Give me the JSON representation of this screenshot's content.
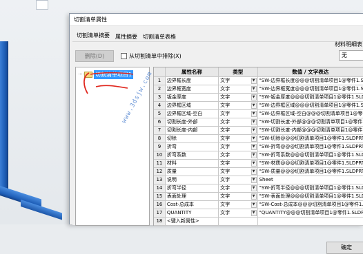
{
  "window": {
    "title": "切割清单属性"
  },
  "tabs": [
    {
      "label": "切割清单摘要"
    },
    {
      "label": "属性摘要"
    },
    {
      "label": "切割清单表格"
    }
  ],
  "toolbar": {
    "delete_label": "删除(D)",
    "exclude_label": "从切割清单中排除(X)",
    "material_label": "材料明细表",
    "material_value": "无"
  },
  "tree": {
    "item_label": "切割清单项目1"
  },
  "table": {
    "headers": [
      "",
      "属性名称",
      "类型",
      "数值 / 文字表达"
    ],
    "rows": [
      {
        "num": "1",
        "name": "边界框长度",
        "type": "文字",
        "value": "\"SW-边界框长度@@@切割清单项目1@零件1.SL"
      },
      {
        "num": "2",
        "name": "边界框宽度",
        "type": "文字",
        "value": "\"SW-边界框宽度@@@切割清单项目1@零件1.SL"
      },
      {
        "num": "3",
        "name": "钣金厚度",
        "type": "文字",
        "value": "\"SW-钣金厚度@@@切割清单项目1@零件1.SLD"
      },
      {
        "num": "4",
        "name": "边界框区域",
        "type": "文字",
        "value": "\"SW-边界框区域@@@切割清单项目1@零件1.SL"
      },
      {
        "num": "5",
        "name": "边界框区域-空白",
        "type": "文字",
        "value": "\"SW-边界框区域-空白@@@切割清单项目1@零件"
      },
      {
        "num": "6",
        "name": "切割长度-外部",
        "type": "文字",
        "value": "\"SW-切割长度-外部@@@切割清单项目1@零件1"
      },
      {
        "num": "7",
        "name": "切割长度-内部",
        "type": "文字",
        "value": "\"SW-切割长度-内部@@@切割清单项目1@零件1"
      },
      {
        "num": "8",
        "name": "切除",
        "type": "文字",
        "value": "\"SW-切除@@@切割清单项目1@零件1.SLDPRT\""
      },
      {
        "num": "9",
        "name": "折弯",
        "type": "文字",
        "value": "\"SW-折弯@@@切割清单项目1@零件1.SLDPRT\""
      },
      {
        "num": "10",
        "name": "折弯系数",
        "type": "文字",
        "value": "\"SW-折弯系数@@@切割清单项目1@零件1.SLD"
      },
      {
        "num": "11",
        "name": "材料",
        "type": "文字",
        "value": "\"SW-材质@@@切割清单项目1@零件1.SLDPRT\""
      },
      {
        "num": "12",
        "name": "质量",
        "type": "文字",
        "value": "\"SW-质量@@@切割清单项目1@零件1.SLDPRT\""
      },
      {
        "num": "13",
        "name": "说明",
        "type": "文字",
        "value": "Sheet"
      },
      {
        "num": "14",
        "name": "折弯半径",
        "type": "文字",
        "value": "\"SW-折弯半径@@@切割清单项目1@零件1.SLD"
      },
      {
        "num": "15",
        "name": "表面处理",
        "type": "文字",
        "value": "\"SW-表面处理@@@切割清单项目1@零件1.SLDP"
      },
      {
        "num": "16",
        "name": "Cost-总成本",
        "type": "文字",
        "value": "\"SW-Cost-总成本@@@切割清单项目1@零件1.S"
      },
      {
        "num": "17",
        "name": "QUANTITY",
        "type": "文字",
        "value": "\"QUANTITY@@@切割清单项目1@零件1.SLDPRT"
      },
      {
        "num": "18",
        "name": "<键入新属性>",
        "type": "",
        "value": ""
      }
    ]
  },
  "footer": {
    "ok_label": "确定"
  },
  "watermark": "www.3dsjw.com",
  "colors": {
    "accent": "#0078d7",
    "tree_selection": "#3399ff",
    "annotation": "#e0261d",
    "beam": "#1f5fb8"
  }
}
